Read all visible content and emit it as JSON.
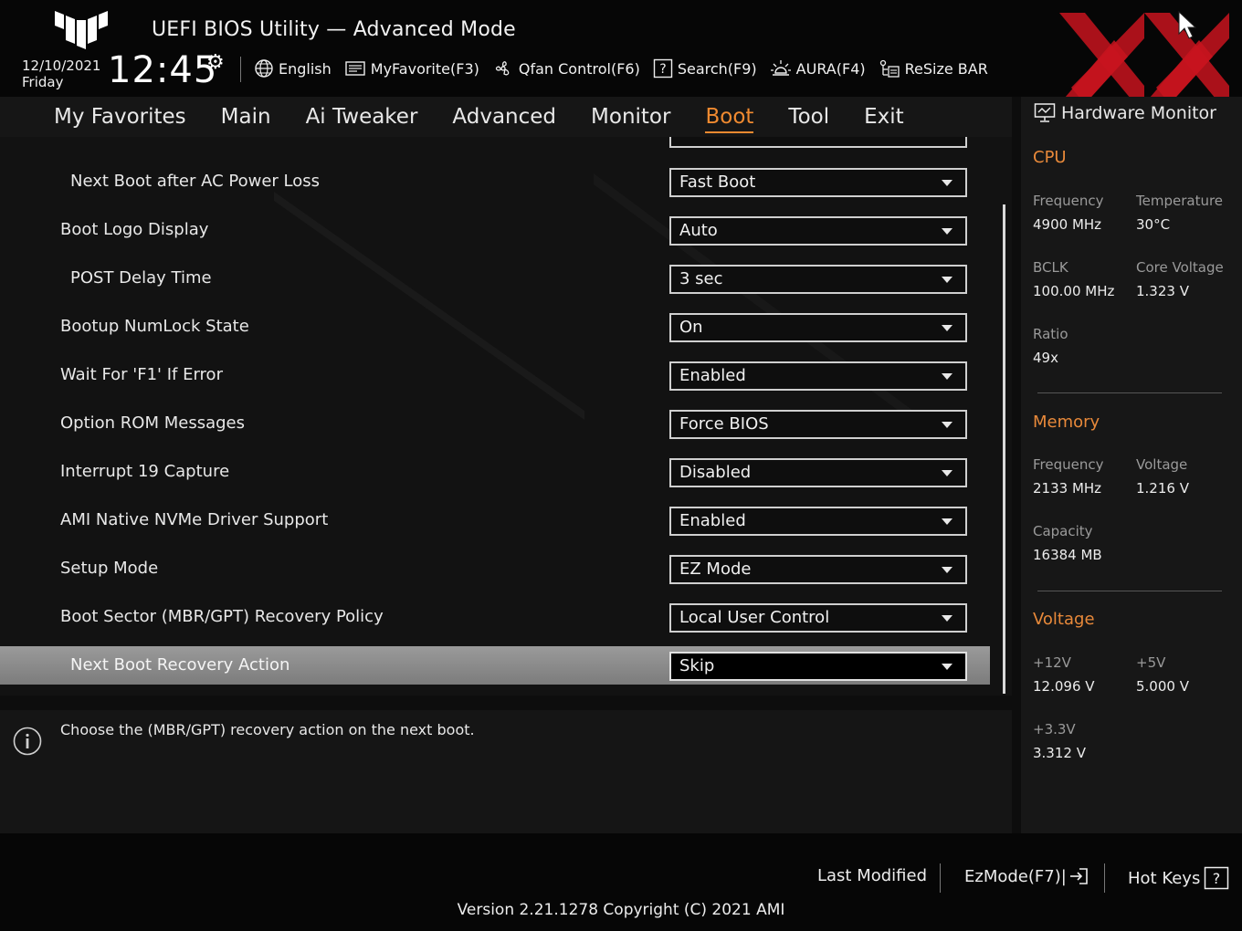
{
  "header": {
    "title": "UEFI BIOS Utility — Advanced Mode",
    "date": "12/10/2021",
    "day": "Friday",
    "time": "12:45",
    "toolbar": [
      {
        "name": "language-button",
        "icon": "globe-icon",
        "label": "English"
      },
      {
        "name": "myfavorite-button",
        "icon": "favorite-list-icon",
        "label": "MyFavorite(F3)"
      },
      {
        "name": "qfan-control-button",
        "icon": "fan-icon",
        "label": "Qfan Control(F6)"
      },
      {
        "name": "search-button",
        "icon": "question-box-icon",
        "label": "Search(F9)"
      },
      {
        "name": "aura-button",
        "icon": "aura-light-icon",
        "label": "AURA(F4)"
      },
      {
        "name": "resize-bar-button",
        "icon": "resize-bar-icon",
        "label": "ReSize BAR"
      }
    ]
  },
  "tabs": [
    {
      "label": "My Favorites",
      "active": false
    },
    {
      "label": "Main",
      "active": false
    },
    {
      "label": "Ai Tweaker",
      "active": false
    },
    {
      "label": "Advanced",
      "active": false
    },
    {
      "label": "Monitor",
      "active": false
    },
    {
      "label": "Boot",
      "active": true
    },
    {
      "label": "Tool",
      "active": false
    },
    {
      "label": "Exit",
      "active": false
    }
  ],
  "settings": [
    {
      "label": "Next Boot after AC Power Loss",
      "value": "Fast Boot",
      "indent": true
    },
    {
      "label": "Boot Logo Display",
      "value": "Auto",
      "indent": false
    },
    {
      "label": "POST Delay Time",
      "value": "3 sec",
      "indent": true
    },
    {
      "label": "Bootup NumLock State",
      "value": "On",
      "indent": false
    },
    {
      "label": "Wait For 'F1' If Error",
      "value": "Enabled",
      "indent": false
    },
    {
      "label": "Option ROM Messages",
      "value": "Force BIOS",
      "indent": false
    },
    {
      "label": "Interrupt 19 Capture",
      "value": "Disabled",
      "indent": false
    },
    {
      "label": "AMI Native NVMe Driver Support",
      "value": "Enabled",
      "indent": false
    },
    {
      "label": "Setup Mode",
      "value": "EZ Mode",
      "indent": false
    },
    {
      "label": "Boot Sector (MBR/GPT) Recovery Policy",
      "value": "Local User Control",
      "indent": false
    },
    {
      "label": "Next Boot Recovery Action",
      "value": "Skip",
      "indent": true,
      "selected": true
    }
  ],
  "help": {
    "text": "Choose the (MBR/GPT) recovery action on the next boot."
  },
  "hardware_monitor": {
    "title": "Hardware Monitor",
    "cpu": {
      "heading": "CPU",
      "frequency_label": "Frequency",
      "frequency": "4900 MHz",
      "temperature_label": "Temperature",
      "temperature": "30°C",
      "bclk_label": "BCLK",
      "bclk": "100.00 MHz",
      "core_voltage_label": "Core Voltage",
      "core_voltage": "1.323 V",
      "ratio_label": "Ratio",
      "ratio": "49x"
    },
    "memory": {
      "heading": "Memory",
      "frequency_label": "Frequency",
      "frequency": "2133 MHz",
      "voltage_label": "Voltage",
      "voltage": "1.216 V",
      "capacity_label": "Capacity",
      "capacity": "16384 MB"
    },
    "voltage": {
      "heading": "Voltage",
      "v12_label": "+12V",
      "v12": "12.096 V",
      "v5_label": "+5V",
      "v5": "5.000 V",
      "v33_label": "+3.3V",
      "v33": "3.312 V"
    }
  },
  "footer": {
    "last_modified": "Last Modified",
    "ezmode": "EzMode(F7)|",
    "hotkeys": "Hot Keys",
    "version": "Version 2.21.1278 Copyright (C) 2021 AMI"
  },
  "colors": {
    "accent": "#f08a30",
    "background": "#0d0d0d",
    "selected_row": "#8a8a8a",
    "watermark_red": "#c8141e"
  }
}
